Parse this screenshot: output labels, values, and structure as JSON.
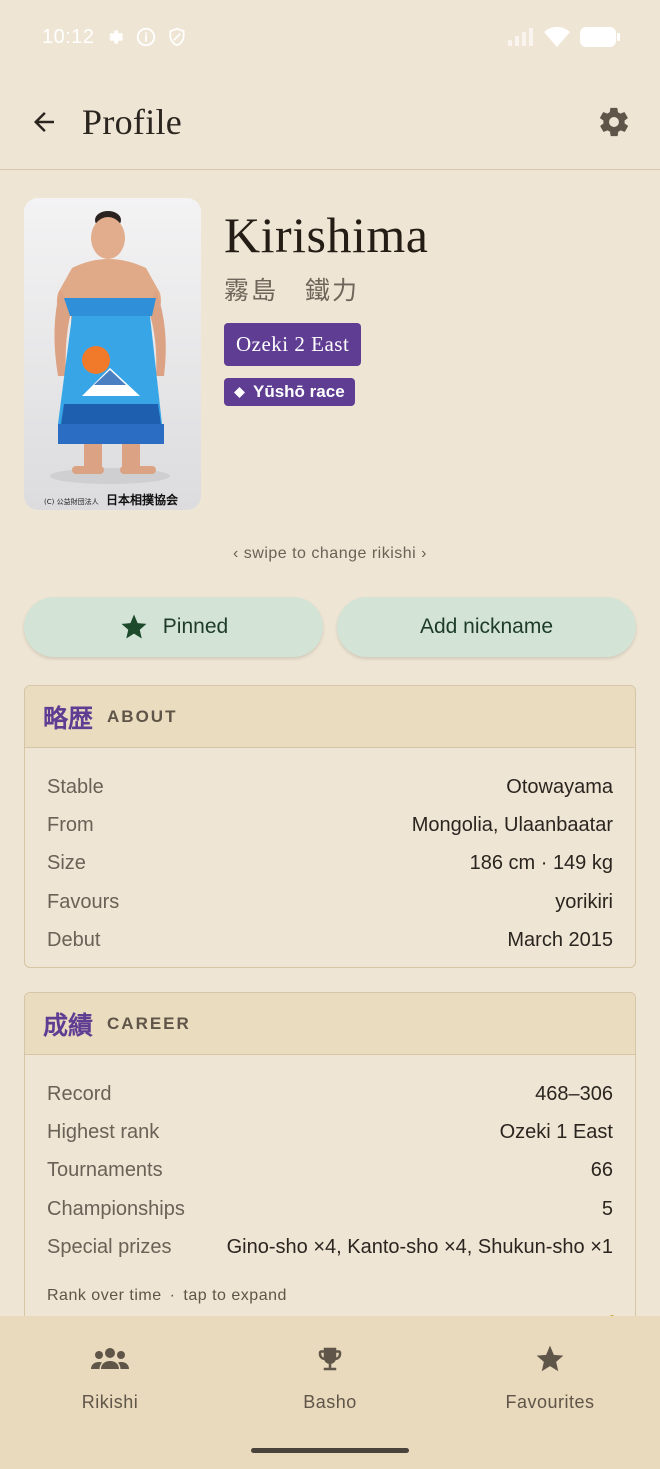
{
  "status_bar": {
    "time": "10:12",
    "icons_left": [
      "settings-icon",
      "info-icon",
      "shield-icon"
    ],
    "icons_right": [
      "signal-icon",
      "wifi-icon",
      "battery-icon"
    ]
  },
  "app_bar": {
    "title": "Profile",
    "back_icon": "arrow-left-icon",
    "settings_icon": "gear-icon"
  },
  "rikishi": {
    "name": "Kirishima",
    "kanji_name": "霧島　鐵力",
    "rank": "Ozeki 2 East",
    "yusho_tag": "Yūshō race",
    "portrait_caption": "(C) 公益財団法人 日本相撲協会"
  },
  "swipe_hint": "‹ swipe to change rikishi ›",
  "actions": {
    "pinned_label": "Pinned",
    "nickname_label": "Add nickname"
  },
  "about": {
    "kanji": "略歴",
    "title": "ABOUT",
    "rows": [
      {
        "label": "Stable",
        "value": "Otowayama"
      },
      {
        "label": "From",
        "value": "Mongolia, Ulaanbaatar"
      },
      {
        "label": "Size",
        "value": "186 cm · 149 kg"
      },
      {
        "label": "Favours",
        "value": "yorikiri"
      },
      {
        "label": "Debut",
        "value": "March 2015"
      }
    ]
  },
  "career": {
    "kanji": "成績",
    "title": "CAREER",
    "rows": [
      {
        "label": "Record",
        "value": "468–306"
      },
      {
        "label": "Highest rank",
        "value": "Ozeki 1 East"
      },
      {
        "label": "Tournaments",
        "value": "66"
      },
      {
        "label": "Championships",
        "value": "5"
      },
      {
        "label": "Special prizes",
        "value": "Gino-sho ×4, Kanto-sho ×4, Shukun-sho ×1"
      }
    ],
    "rank_caption": "Rank over time",
    "rank_caption_hint": "tap to expand",
    "rank_caption_sep": "·"
  },
  "bottom_nav": {
    "items": [
      {
        "label": "Rikishi",
        "icon": "group-icon"
      },
      {
        "label": "Basho",
        "icon": "trophy-icon"
      },
      {
        "label": "Favourites",
        "icon": "star-icon"
      }
    ]
  },
  "colors": {
    "background": "#efe5d4",
    "accent_purple": "#5f3d93",
    "button_green": "#d3e3d6",
    "card_header": "#eadcbf",
    "nav_background": "#e9dabd"
  }
}
